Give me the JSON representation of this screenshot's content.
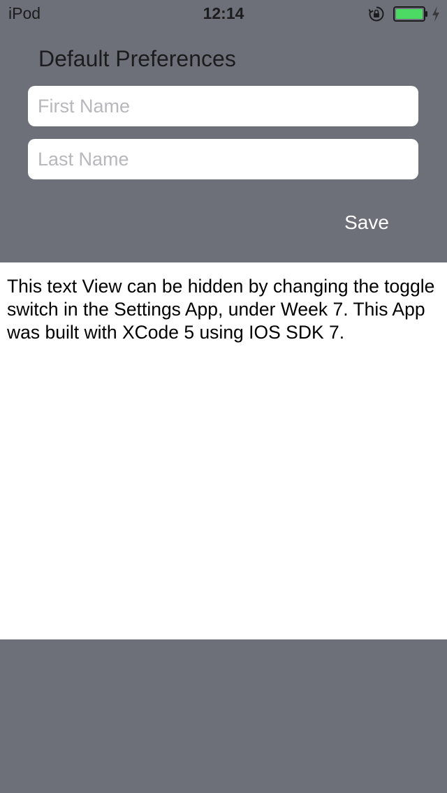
{
  "status_bar": {
    "carrier": "iPod",
    "time": "12:14",
    "icons": [
      "orientation-lock-icon",
      "battery-icon",
      "charging-icon"
    ],
    "battery_color": "#4cd964"
  },
  "header": {
    "title": "Default Preferences"
  },
  "form": {
    "first_name": {
      "value": "",
      "placeholder": "First Name"
    },
    "last_name": {
      "value": "",
      "placeholder": "Last Name"
    },
    "save_label": "Save"
  },
  "text_view": {
    "content": "This text View can be hidden by changing the toggle switch in the Settings App, under Week 7. This App was built with XCode 5 using IOS SDK 7."
  },
  "colors": {
    "background": "#6e7079",
    "field_background": "#ffffff",
    "text_view_background": "#ffffff"
  }
}
